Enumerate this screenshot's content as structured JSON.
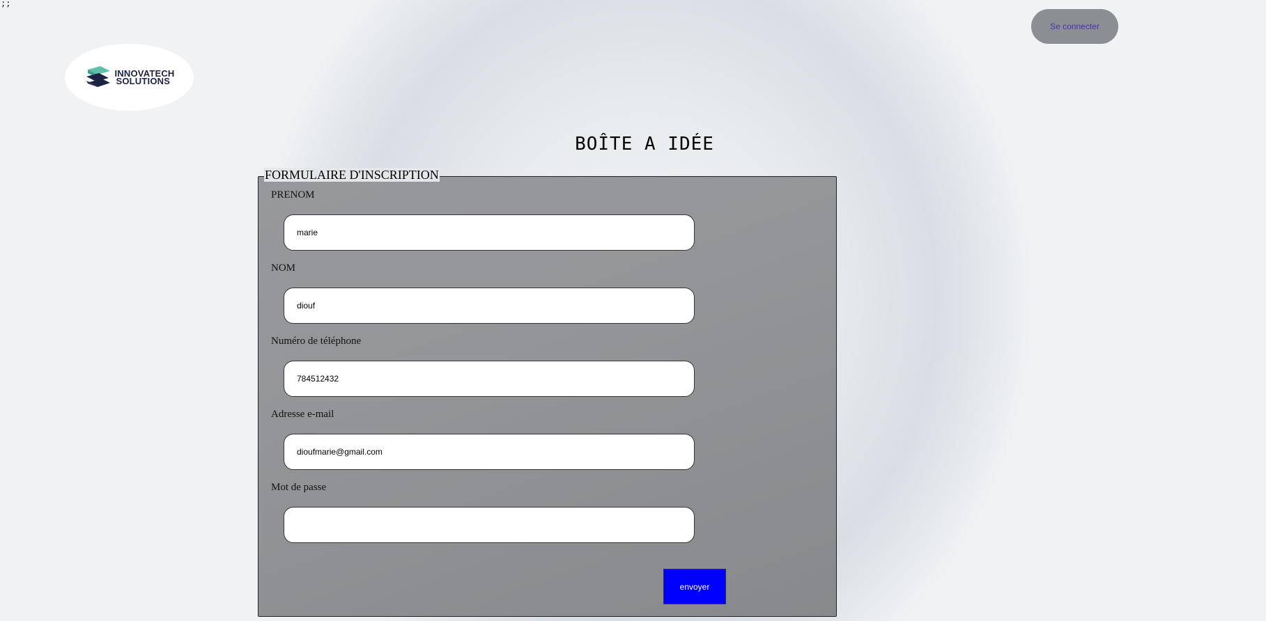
{
  "stray_text": ";;",
  "brand": {
    "line1": "INNOVATECH",
    "line2": "SOLUTIONS",
    "colors": {
      "dark": "#1d2245",
      "teal": "#5fbfa8"
    }
  },
  "header": {
    "login_label": "Se connecter"
  },
  "page": {
    "title": "BOÎTE A IDÉE"
  },
  "form": {
    "legend": "FORMULAIRE D'INSCRIPTION",
    "fields": [
      {
        "label": "PRENOM",
        "value": "marie"
      },
      {
        "label": "NOM",
        "value": "diouf"
      },
      {
        "label": "Numéro de téléphone",
        "value": "784512432"
      },
      {
        "label": "Adresse e-mail",
        "value": "dioufmarie@gmail.com"
      },
      {
        "label": "Mot de passe",
        "value": ""
      }
    ],
    "submit_label": "envoyer"
  },
  "colors": {
    "form_background": "#939598",
    "submit_background": "#0000ff",
    "login_background": "#8b8f94",
    "login_text": "#4a2ea8"
  }
}
